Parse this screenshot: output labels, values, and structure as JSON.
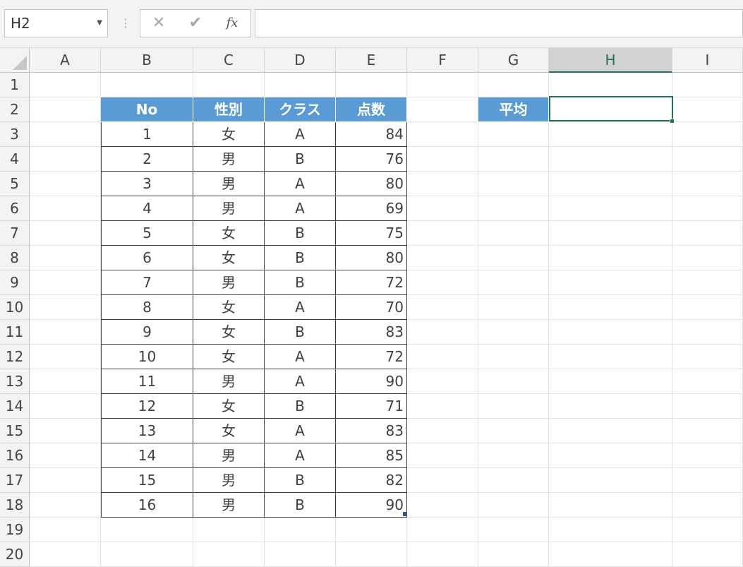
{
  "formula_bar": {
    "name_box": "H2",
    "cancel_icon": "✕",
    "enter_icon": "✔",
    "fx_label": "fx",
    "formula": ""
  },
  "columns": [
    "A",
    "B",
    "C",
    "D",
    "E",
    "F",
    "G",
    "H",
    "I"
  ],
  "rows": [
    "1",
    "2",
    "3",
    "4",
    "5",
    "6",
    "7",
    "8",
    "9",
    "10",
    "11",
    "12",
    "13",
    "14",
    "15",
    "16",
    "17",
    "18",
    "19",
    "20"
  ],
  "table": {
    "headers": [
      "No",
      "性別",
      "クラス",
      "点数"
    ],
    "rows": [
      [
        "1",
        "女",
        "A",
        "84"
      ],
      [
        "2",
        "男",
        "B",
        "76"
      ],
      [
        "3",
        "男",
        "A",
        "80"
      ],
      [
        "4",
        "男",
        "A",
        "69"
      ],
      [
        "5",
        "女",
        "B",
        "75"
      ],
      [
        "6",
        "女",
        "B",
        "80"
      ],
      [
        "7",
        "男",
        "B",
        "72"
      ],
      [
        "8",
        "女",
        "A",
        "70"
      ],
      [
        "9",
        "女",
        "B",
        "83"
      ],
      [
        "10",
        "女",
        "A",
        "72"
      ],
      [
        "11",
        "男",
        "A",
        "90"
      ],
      [
        "12",
        "女",
        "B",
        "71"
      ],
      [
        "13",
        "女",
        "A",
        "83"
      ],
      [
        "14",
        "男",
        "A",
        "85"
      ],
      [
        "15",
        "男",
        "B",
        "82"
      ],
      [
        "16",
        "男",
        "B",
        "90"
      ]
    ]
  },
  "average": {
    "label": "平均",
    "value": ""
  },
  "colors": {
    "header_fill": "#5b9bd5",
    "selection": "#217346",
    "grid": "#e1e1e1"
  }
}
